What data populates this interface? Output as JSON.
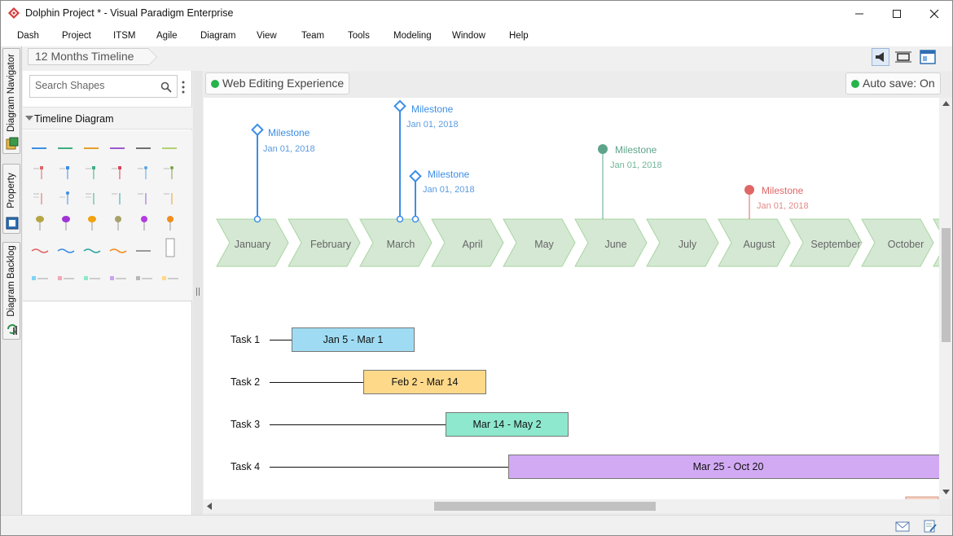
{
  "window": {
    "title": "Dolphin Project * - Visual Paradigm Enterprise",
    "minimize": "—",
    "maximize": "☐",
    "close": "✕"
  },
  "menu": [
    "Dash",
    "Project",
    "ITSM",
    "Agile",
    "Diagram",
    "View",
    "Team",
    "Tools",
    "Modeling",
    "Window",
    "Help"
  ],
  "side_tabs": [
    "Diagram Navigator",
    "Property",
    "Diagram Backlog"
  ],
  "breadcrumb": "12 Months Timeline",
  "shape_panel": {
    "search_placeholder": "Search Shapes",
    "section": "Timeline Diagram"
  },
  "canvas": {
    "left_status": "Web Editing Experience",
    "right_status": "Auto save: On"
  },
  "timeline": {
    "months": [
      "January",
      "February",
      "March",
      "April",
      "May",
      "June",
      "July",
      "August",
      "September",
      "October"
    ],
    "milestones": [
      {
        "title": "Milestone",
        "date": "Jan 01, 2018",
        "color": "#3d8ee6"
      },
      {
        "title": "Milestone",
        "date": "Jan 01, 2018",
        "color": "#3d8ee6"
      },
      {
        "title": "Milestone",
        "date": "Jan 01, 2018",
        "color": "#3d8ee6"
      },
      {
        "title": "Milestone",
        "date": "Jan 01, 2018",
        "color": "#5ea48a"
      },
      {
        "title": "Milestone",
        "date": "Jan 01, 2018",
        "color": "#e06666"
      }
    ],
    "tasks": [
      {
        "name": "Task 1",
        "range": "Jan 5 - Mar 1",
        "color": "#9fdcf3"
      },
      {
        "name": "Task 2",
        "range": "Feb 2 - Mar 14",
        "color": "#ffd98a"
      },
      {
        "name": "Task 3",
        "range": "Mar 14 - May 2",
        "color": "#8de8cd"
      },
      {
        "name": "Task 4",
        "range": "Mar 25 - Oct 20",
        "color": "#d2aaf4"
      }
    ]
  },
  "colors": {
    "month_fill": "#d5e8d4",
    "month_stroke": "#a8d5a0",
    "status_dot": "#25b34a"
  },
  "icons": {
    "app": "visual-paradigm-logo-icon",
    "search": "search-icon",
    "menu": "kebab-menu-icon",
    "statusbar": [
      "mail-icon",
      "document-edit-icon"
    ],
    "toolbar": [
      "megaphone-icon",
      "fit-view-icon",
      "layout-icon"
    ]
  }
}
